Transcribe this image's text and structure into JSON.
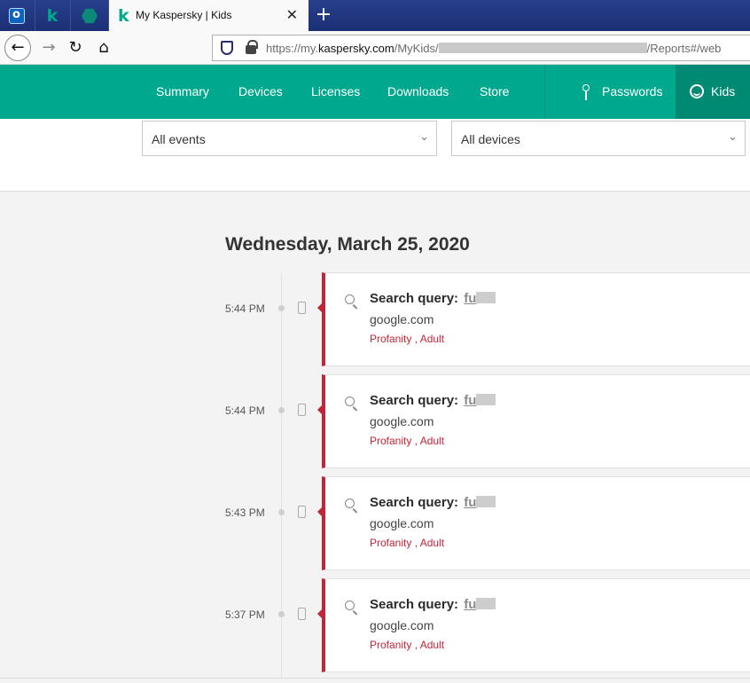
{
  "browser": {
    "pinned_tabs": [
      {
        "icon": "outlook-icon"
      },
      {
        "icon": "kaspersky-k-icon"
      },
      {
        "icon": "hexagon-app-icon"
      }
    ],
    "active_tab": {
      "title": "My Kaspersky | Kids",
      "icon": "kaspersky-k-icon",
      "close": "✕"
    },
    "new_tab": "+",
    "url": {
      "prefix": "https://my.",
      "domain": "kaspersky.com",
      "path": "/MyKids/",
      "suffix": "/Reports#/web"
    },
    "nav_icons": {
      "back": "←",
      "forward": "→",
      "reload": "↻",
      "home": "⌂"
    }
  },
  "site_nav": {
    "items": [
      "Summary",
      "Devices",
      "Licenses",
      "Downloads",
      "Store"
    ],
    "passwords": "Passwords",
    "kids": "Kids",
    "color": "#00a88e"
  },
  "filters": {
    "events": "All events",
    "devices": "All devices",
    "chevron": "⌄"
  },
  "report": {
    "date": "Wednesday, March 25, 2020",
    "events": [
      {
        "time": "5:44 PM",
        "label": "Search query:",
        "term": "fu",
        "site": "google.com",
        "categories": "Profanity , Adult"
      },
      {
        "time": "5:44 PM",
        "label": "Search query:",
        "term": "fu",
        "site": "google.com",
        "categories": "Profanity , Adult"
      },
      {
        "time": "5:43 PM",
        "label": "Search query:",
        "term": "fu",
        "site": "google.com",
        "categories": "Profanity , Adult"
      },
      {
        "time": "5:37 PM",
        "label": "Search query:",
        "term": "fu",
        "site": "google.com",
        "categories": "Profanity , Adult"
      }
    ],
    "accent_color": "#c0253a"
  }
}
